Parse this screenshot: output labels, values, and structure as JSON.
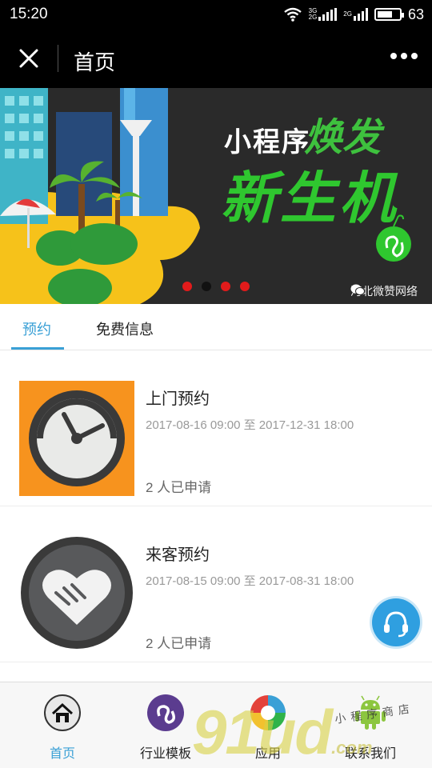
{
  "status": {
    "time": "15:20",
    "net1": "3G",
    "net2": "2G",
    "net3": "2G",
    "battery": "63"
  },
  "nav": {
    "title": "首页"
  },
  "banner": {
    "headline_a": "小程序",
    "headline_b": "焕发",
    "headline_c": "新生机",
    "brand": "河北微赞网络",
    "slide_count": 4,
    "active_slide": 2
  },
  "tabs": [
    {
      "label": "预约",
      "active": true
    },
    {
      "label": "免费信息",
      "active": false
    }
  ],
  "items": [
    {
      "title": "上门预约",
      "period": "2017-08-16 09:00 至 2017-12-31 18:00",
      "count": "2 人已申请"
    },
    {
      "title": "来客预约",
      "period": "2017-08-15 09:00 至 2017-08-31 18:00",
      "count": "2 人已申请"
    }
  ],
  "tabbar": [
    {
      "label": "首页",
      "icon": "home-icon",
      "active": true
    },
    {
      "label": "行业模板",
      "icon": "miniprogram-icon",
      "active": false
    },
    {
      "label": "应用",
      "icon": "app-icon",
      "active": false
    },
    {
      "label": "联系我们",
      "icon": "android-icon",
      "active": false
    }
  ],
  "watermark": {
    "text": "91ud",
    "suffix": ".com",
    "tagline": "小程序商店"
  },
  "colors": {
    "accent": "#3aa0d6",
    "banner_green": "#2fc72f",
    "dot_red": "#e21b1b",
    "fab_blue": "#2f9fe0"
  }
}
